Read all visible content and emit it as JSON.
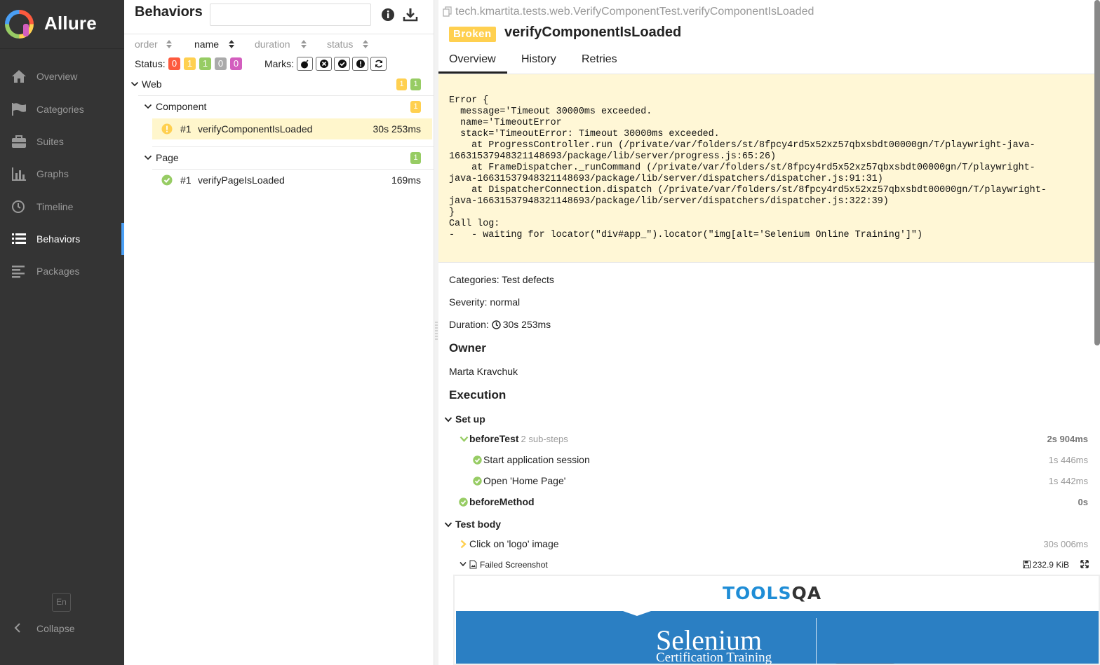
{
  "app": {
    "name": "Allure"
  },
  "nav": {
    "items": [
      {
        "label": "Overview",
        "icon": "home-icon"
      },
      {
        "label": "Categories",
        "icon": "flag-icon"
      },
      {
        "label": "Suites",
        "icon": "briefcase-icon"
      },
      {
        "label": "Graphs",
        "icon": "bar-chart-icon"
      },
      {
        "label": "Timeline",
        "icon": "clock-icon"
      },
      {
        "label": "Behaviors",
        "icon": "list-icon",
        "active": true
      },
      {
        "label": "Packages",
        "icon": "align-left-icon"
      }
    ],
    "lang": "En",
    "collapse": "Collapse"
  },
  "tree": {
    "title": "Behaviors",
    "search": {
      "value": "",
      "placeholder": ""
    },
    "sort": {
      "order": "order",
      "name": "name",
      "duration": "duration",
      "status": "status",
      "active": "name"
    },
    "status_label": "Status:",
    "status_counts": [
      {
        "value": "0",
        "color": "#fd5a3e",
        "status": "failed"
      },
      {
        "value": "1",
        "color": "#ffd050",
        "status": "broken"
      },
      {
        "value": "1",
        "color": "#97cc64",
        "status": "passed"
      },
      {
        "value": "0",
        "color": "#aaaaaa",
        "status": "skipped"
      },
      {
        "value": "0",
        "color": "#d35ebe",
        "status": "unknown"
      }
    ],
    "marks_label": "Marks:",
    "groups": {
      "web": {
        "name": "Web",
        "broken": "1",
        "passed": "1"
      },
      "component": {
        "name": "Component",
        "broken": "1"
      },
      "page": {
        "name": "Page",
        "passed": "1"
      }
    },
    "tests": {
      "component": {
        "num": "#1",
        "name": "verifyComponentIsLoaded",
        "duration": "30s 253ms",
        "status": "broken"
      },
      "page": {
        "num": "#1",
        "name": "verifyPageIsLoaded",
        "duration": "169ms",
        "status": "passed"
      }
    }
  },
  "detail": {
    "fullname": "tech.kmartita.tests.web.VerifyComponentTest.verifyComponentIsLoaded",
    "status": "Broken",
    "title": "verifyComponentIsLoaded",
    "tabs": [
      "Overview",
      "History",
      "Retries"
    ],
    "error": "Error {\n  message='Timeout 30000ms exceeded.\n  name='TimeoutError\n  stack='TimeoutError: Timeout 30000ms exceeded.\n    at ProgressController.run (/private/var/folders/st/8fpcy4rd5x52xz57qbxsbdt00000gn/T/playwright-java-\n16631537948321148693/package/lib/server/progress.js:65:26)\n    at FrameDispatcher._runCommand (/private/var/folders/st/8fpcy4rd5x52xz57qbxsbdt00000gn/T/playwright-\njava-16631537948321148693/package/lib/server/dispatchers/dispatcher.js:91:31)\n    at DispatcherConnection.dispatch (/private/var/folders/st/8fpcy4rd5x52xz57qbxsbdt00000gn/T/playwright-\njava-16631537948321148693/package/lib/server/dispatchers/dispatcher.js:322:39)\n}\nCall log:\n-   - waiting for locator(\"div#app_\").locator(\"img[alt='Selenium Online Training']\")",
    "categories": "Categories: Test defects",
    "severity": "Severity: normal",
    "duration_label": "Duration:",
    "duration_value": "30s 253ms",
    "owner_heading": "Owner",
    "owner": "Marta Kravchuk",
    "execution_heading": "Execution",
    "setup": {
      "title": "Set up",
      "before_test": {
        "name": "beforeTest",
        "sub": "2 sub-steps",
        "duration": "2s 904ms"
      },
      "substeps": [
        {
          "name": "Start application session",
          "duration": "1s 446ms"
        },
        {
          "name": "Open 'Home Page'",
          "duration": "1s 442ms"
        }
      ],
      "before_method": {
        "name": "beforeMethod",
        "duration": "0s"
      }
    },
    "body": {
      "title": "Test body",
      "step": {
        "name": "Click on 'logo' image",
        "duration": "30s 006ms"
      },
      "attachment": {
        "name": "Failed Screenshot",
        "size": "232.9 KiB"
      }
    },
    "screenshot": {
      "logo_main": "TOOLS",
      "logo_accent": "QA",
      "headline": "Selenium",
      "subline": "Certification Training"
    }
  },
  "colors": {
    "sidebar_bg": "#343434",
    "accent": "#4a9ff5",
    "broken": "#ffd050",
    "passed": "#97cc64",
    "failed": "#fd5a3e",
    "error_bg": "#fff7d6"
  }
}
